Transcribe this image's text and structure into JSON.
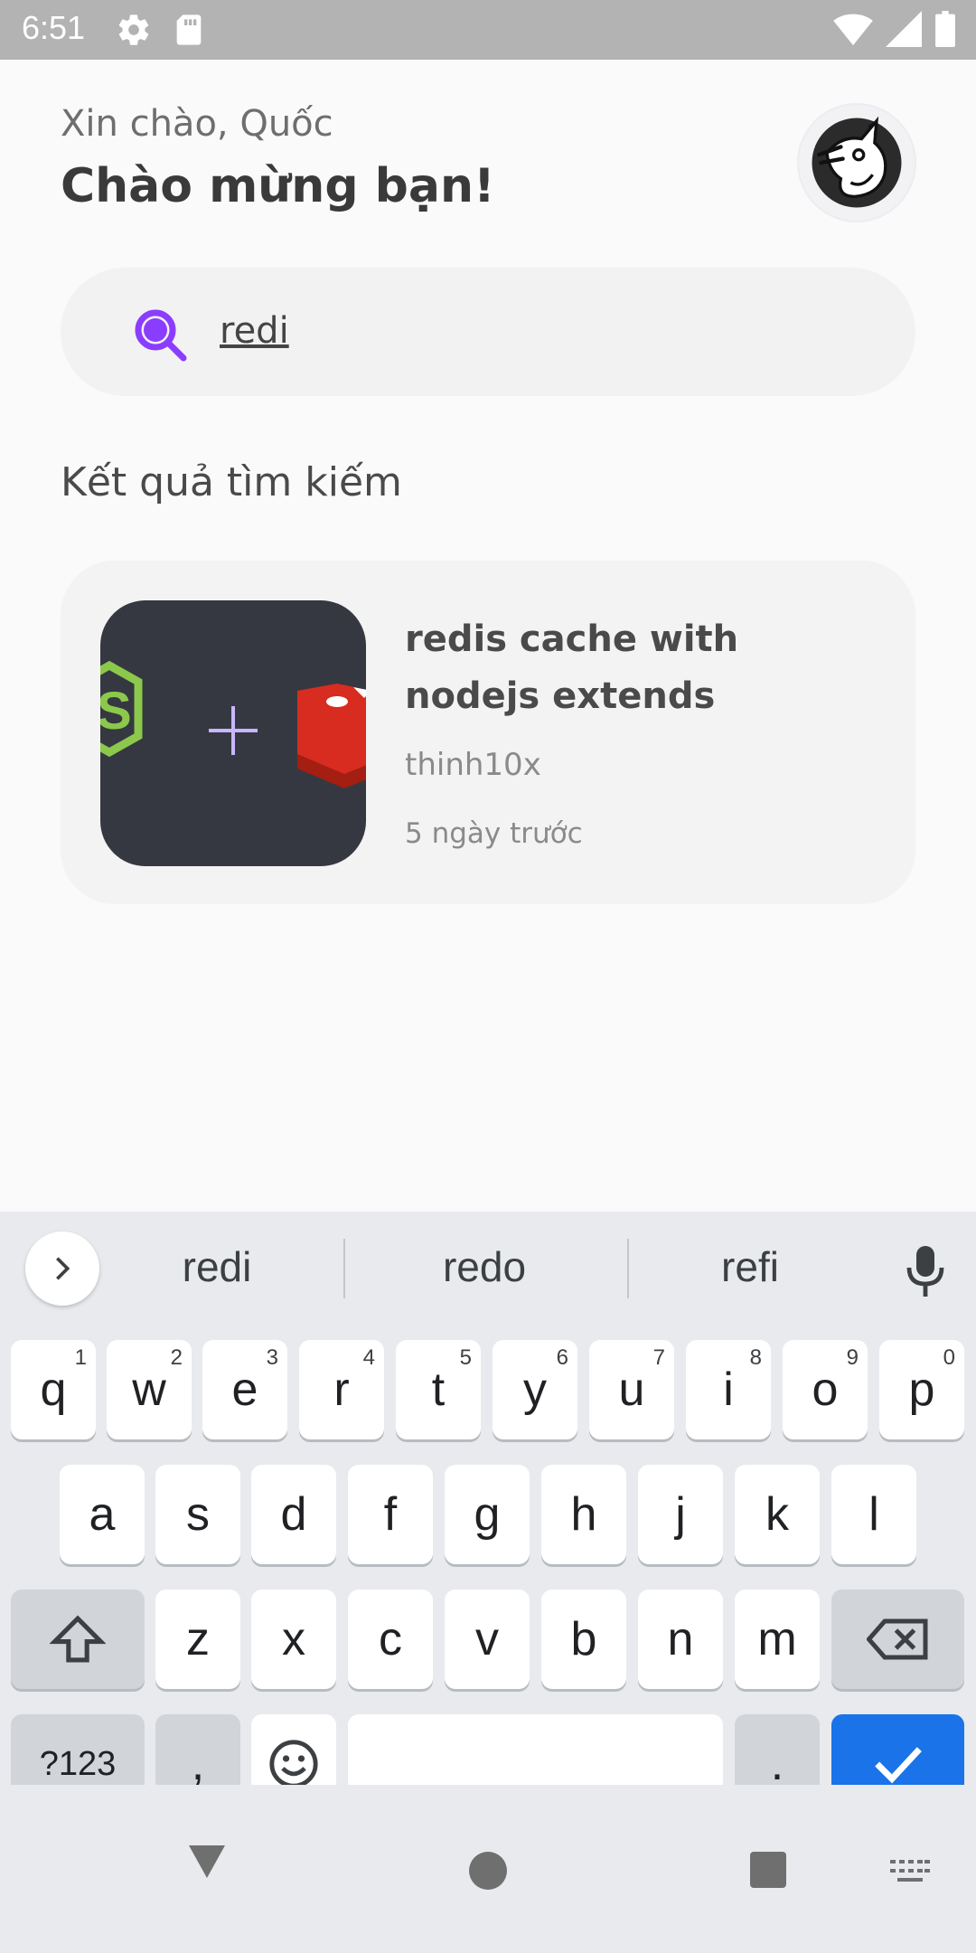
{
  "status_bar": {
    "time": "6:51",
    "icons_left": [
      "settings-icon",
      "sd-card-icon"
    ],
    "icons_right": [
      "wifi-icon",
      "cell-signal-icon",
      "battery-icon"
    ]
  },
  "header": {
    "greeting": "Xin chào, Quốc",
    "welcome": "Chào mừng bạn!"
  },
  "search": {
    "value": "redi",
    "accent_color": "#8b3dff"
  },
  "results": {
    "title": "Kết quả tìm kiếm",
    "items": [
      {
        "title": "redis cache with nodejs extends",
        "author": "thinh10x",
        "time": "5 ngày trước",
        "thumbnail_plus": "+"
      }
    ]
  },
  "keyboard": {
    "suggestions": [
      "redi",
      "redo",
      "refi"
    ],
    "row1": [
      {
        "k": "q",
        "h": "1"
      },
      {
        "k": "w",
        "h": "2"
      },
      {
        "k": "e",
        "h": "3"
      },
      {
        "k": "r",
        "h": "4"
      },
      {
        "k": "t",
        "h": "5"
      },
      {
        "k": "y",
        "h": "6"
      },
      {
        "k": "u",
        "h": "7"
      },
      {
        "k": "i",
        "h": "8"
      },
      {
        "k": "o",
        "h": "9"
      },
      {
        "k": "p",
        "h": "0"
      }
    ],
    "row2": [
      "a",
      "s",
      "d",
      "f",
      "g",
      "h",
      "j",
      "k",
      "l"
    ],
    "row3": [
      "z",
      "x",
      "c",
      "v",
      "b",
      "n",
      "m"
    ],
    "symbols_label": "?123",
    "comma_label": ",",
    "period_label": ".",
    "enter_color": "#1a73e8"
  }
}
